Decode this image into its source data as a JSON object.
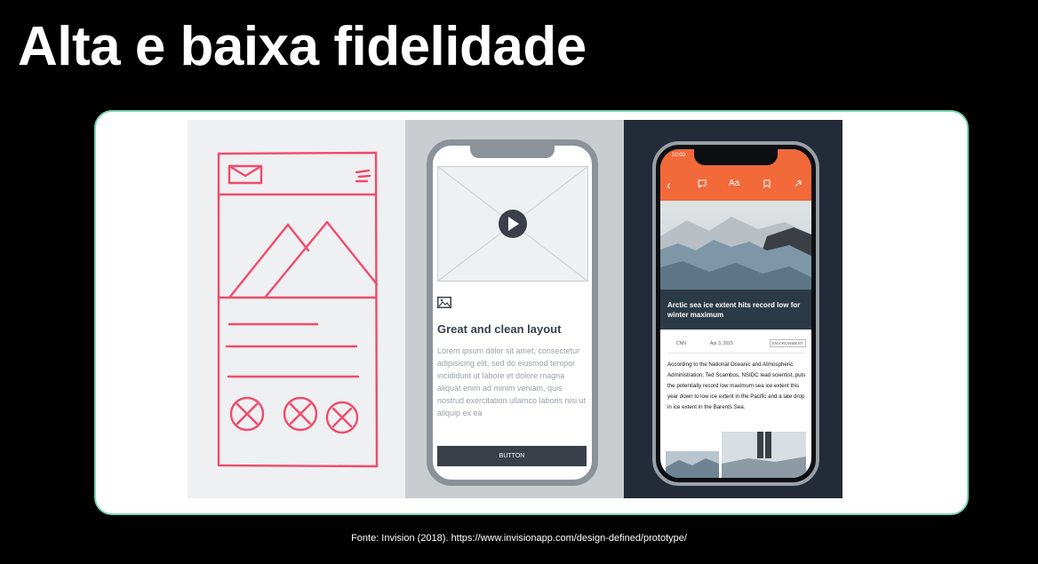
{
  "slide": {
    "title": "Alta e baixa fidelidade",
    "source": "Fonte: Invision (2018). https://www.invisionapp.com/design-defined/prototype/"
  },
  "colors": {
    "background": "#000000",
    "card_border": "#7fd3ba",
    "sketch_red": "#ef4b6c",
    "article_orange": "#f2693a",
    "wire_dark": "#3a3f4a"
  },
  "wireframe_mockup": {
    "heading": "Great and clean layout",
    "body": "Lorem ipsum dolor sit amet, consectetur adipisicing elit, sed do eiusmod tempor incididunt ut labore et dolore magna aliquat enim ad minim veniam, quis nostrud exercitation ullamco laboris nisi ut aliquip ex ea",
    "button_label": "BUTTON",
    "icons": [
      "play-icon",
      "image-icon"
    ]
  },
  "hifi_mockup": {
    "status_time": "10:00",
    "toolbar_icons": [
      "back-icon",
      "comment-icon",
      "text-size-icon",
      "bookmark-icon",
      "share-icon"
    ],
    "font_label": "Aa",
    "headline": "Arctic sea ice extent hits record low for winter maximum",
    "source_name": "CNN",
    "date": "Apr 3, 2015",
    "category": "ENVIRONMENT",
    "article": "According to the National Oceanic and Atmospheric Administration, Ted Scambos, NSIDC lead scientist, puts the potentially record low maximum sea ice extent this year down to low ice extent in the Pacific and a late drop in ice extent in the Barents Sea."
  }
}
